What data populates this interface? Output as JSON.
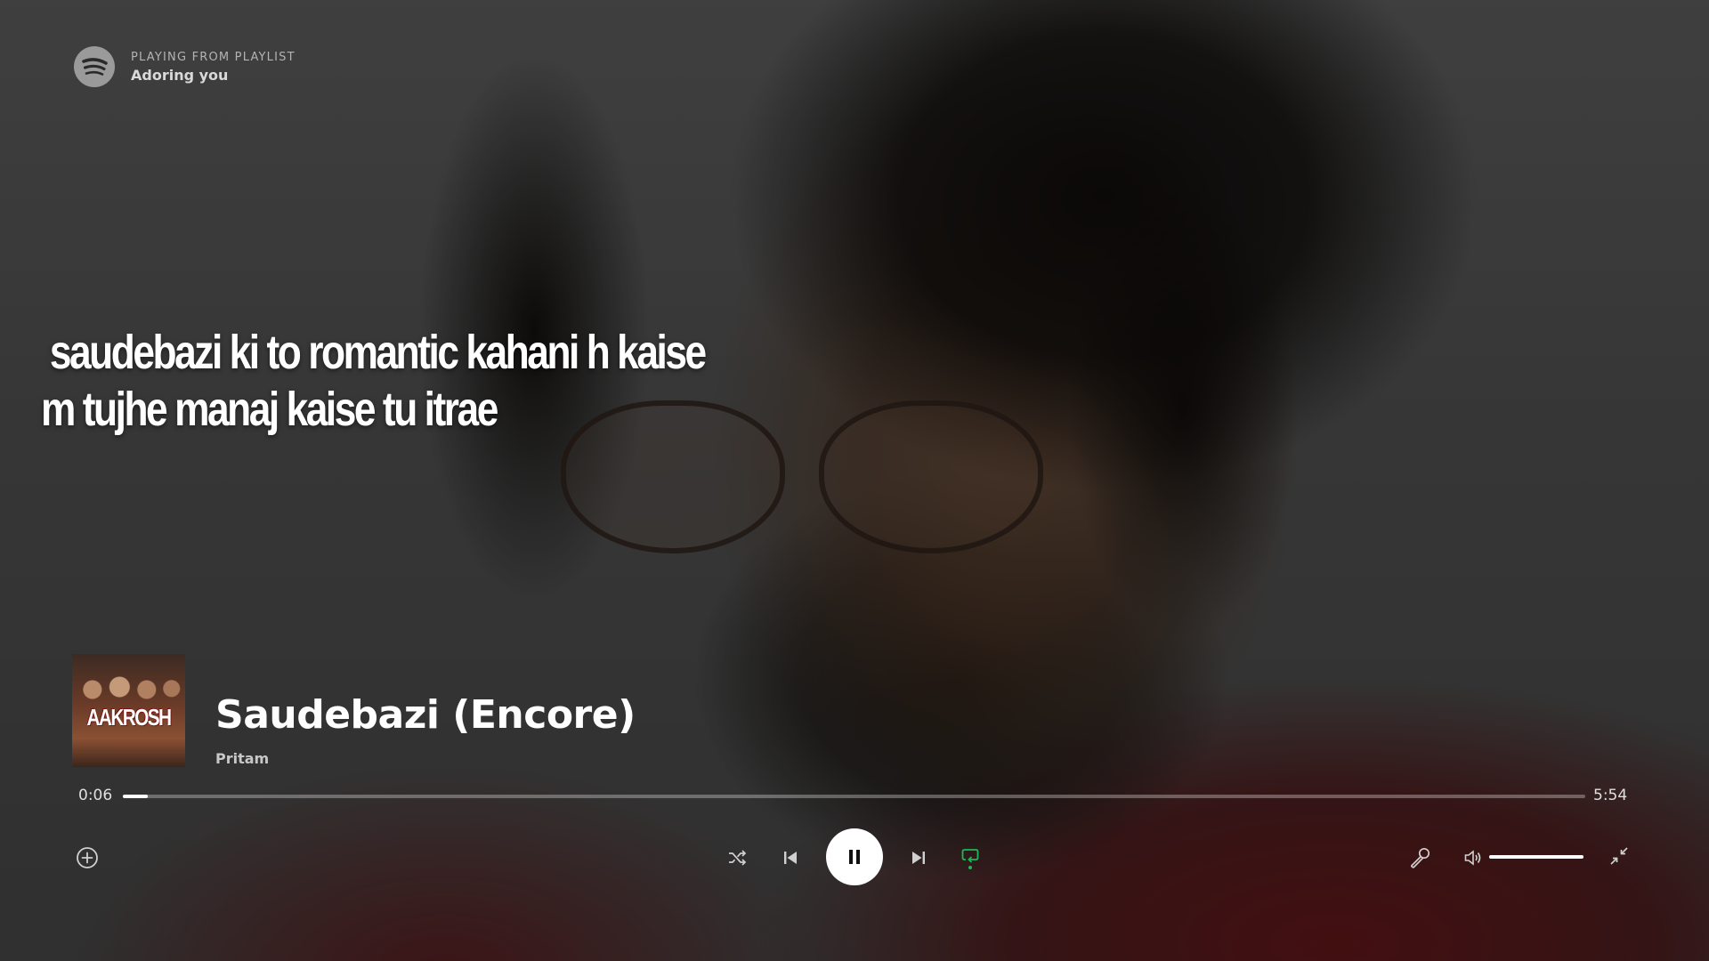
{
  "header": {
    "playing_from_label": "PLAYING FROM PLAYLIST",
    "playlist_name": "Adoring you",
    "logo_icon": "spotify-logo-icon"
  },
  "lyrics": {
    "line_1": " saudebazi ki to romantic kahani h kaise",
    "line_2": "m tujhe manaj kaise tu itrae"
  },
  "track": {
    "title": "Saudebazi (Encore)",
    "artist": "Pritam",
    "cover_text": "AAKROSH"
  },
  "progress": {
    "current": "0:06",
    "total": "5:54",
    "fraction": 0.017
  },
  "controls": {
    "add_icon": "add-circle-icon",
    "shuffle_icon": "shuffle-icon",
    "previous_icon": "skip-previous-icon",
    "play_pause_icon": "pause-icon",
    "next_icon": "skip-next-icon",
    "repeat_icon": "repeat-icon",
    "lyrics_icon": "microphone-icon",
    "volume_icon": "volume-icon",
    "exit_fullscreen_icon": "minimize-icon"
  },
  "volume": {
    "level": 1.0
  },
  "colors": {
    "accent": "#1db954",
    "text_primary": "#ffffff",
    "text_secondary": "#b3b3b3"
  }
}
